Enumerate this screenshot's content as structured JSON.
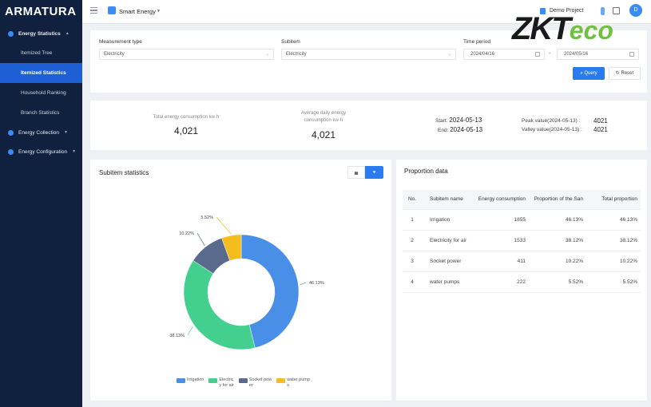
{
  "sidebar": {
    "logo": "ARMATURA",
    "groups": [
      {
        "label": "Energy Statistics",
        "icon": "energy-icon"
      },
      {
        "label": "Energy Collection",
        "icon": "collection-icon"
      },
      {
        "label": "Energy Configuration",
        "icon": "config-icon"
      }
    ],
    "items": [
      {
        "label": "Itemized Tree"
      },
      {
        "label": "Itemized Statistics",
        "active": true
      },
      {
        "label": "Household Ranking"
      },
      {
        "label": "Branch Statistics"
      }
    ]
  },
  "topbar": {
    "app_name": "Smart Energy",
    "project": "Demo Project",
    "avatar": "D"
  },
  "filters": {
    "measurement_type_label": "Measurement type",
    "measurement_type_value": "Electricity",
    "subitem_label": "Subitem",
    "subitem_value": "Electricity",
    "time_period_label": "Time period",
    "start_date": "2024/04/16",
    "end_date": "2024/05/16",
    "range_separator": "-",
    "query_label": "Query",
    "reset_label": "Reset"
  },
  "summary": {
    "total_label_1": "Total energy consumption kw·h",
    "total_value": "4,021",
    "avg_label_1": "Average daily energy",
    "avg_label_2": "consumption kw·h",
    "avg_value": "4,021",
    "start_label": "Start:",
    "start_value": "2024-05-13",
    "end_label": "End:",
    "end_value": "2024-05-13",
    "peak_label": "Peak value(2024-05-13) :",
    "peak_value": "4021",
    "valley_label": "Valley value(2024-05-13) :",
    "valley_value": "4021"
  },
  "subitem_panel": {
    "title": "Subitem statistics",
    "bar_toggle": "▄",
    "pie_toggle": "●"
  },
  "chart_data": {
    "type": "pie",
    "donut": true,
    "categories": [
      "Irrigation",
      "Electricity for air",
      "Socket power",
      "water pumps"
    ],
    "values": [
      46.13,
      38.12,
      10.22,
      5.52
    ],
    "labels": [
      "46.13%",
      "38.13%",
      "10.22%",
      "5.52%"
    ],
    "legend_labels": [
      [
        "Irrigation"
      ],
      [
        "Electric",
        "y for air"
      ],
      [
        "Socket pow",
        "er"
      ],
      [
        "water pump",
        "s"
      ]
    ],
    "colors": [
      "#4a8fe7",
      "#43d08f",
      "#5a6a8c",
      "#f4bc1c"
    ],
    "legend_position": "bottom"
  },
  "proportion": {
    "title": "Proportion data",
    "headers": [
      "No.",
      "Subitem name",
      "Energy consumption",
      "Proportion of the San",
      "Total proportion"
    ],
    "rows": [
      [
        "1",
        "Irrigation",
        "1855",
        "46.13%",
        "46.13%"
      ],
      [
        "2",
        "Electricity for air",
        "1533",
        "38.12%",
        "38.12%"
      ],
      [
        "3",
        "Socket power",
        "411",
        "10.22%",
        "10.22%"
      ],
      [
        "4",
        "water pumps",
        "222",
        "5.52%",
        "5.52%"
      ]
    ]
  },
  "brand": {
    "part1": "ZKT",
    "part2": "eco"
  }
}
